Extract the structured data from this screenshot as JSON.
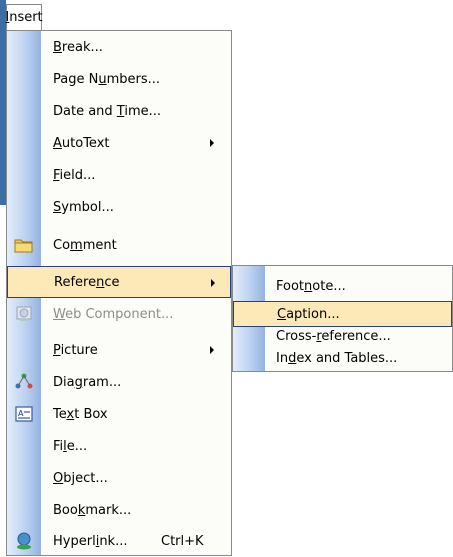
{
  "menu": {
    "title_first": "I",
    "title_rest": "nsert",
    "items": [
      {
        "pre": "",
        "key": "B",
        "post": "reak..."
      },
      {
        "pre": "Page N",
        "key": "u",
        "post": "mbers..."
      },
      {
        "pre": "Date and ",
        "key": "T",
        "post": "ime..."
      },
      {
        "pre": "",
        "key": "A",
        "post": "utoText"
      },
      {
        "pre": "",
        "key": "F",
        "post": "ield..."
      },
      {
        "pre": "",
        "key": "S",
        "post": "ymbol..."
      },
      {
        "pre": "Co",
        "key": "m",
        "post": "ment"
      },
      {
        "pre": "Refere",
        "key": "n",
        "post": "ce"
      },
      {
        "pre": "",
        "key": "W",
        "post": "eb Component..."
      },
      {
        "pre": "",
        "key": "P",
        "post": "icture"
      },
      {
        "pre": "Dia",
        "key": "g",
        "post": "ram..."
      },
      {
        "pre": "Te",
        "key": "x",
        "post": "t Box"
      },
      {
        "pre": "Fi",
        "key": "l",
        "post": "e..."
      },
      {
        "pre": "",
        "key": "O",
        "post": "bject..."
      },
      {
        "pre": "Boo",
        "key": "k",
        "post": "mark..."
      },
      {
        "pre": "Hyperl",
        "key": "i",
        "post": "nk...",
        "shortcut": "Ctrl+K"
      }
    ]
  },
  "submenu": {
    "items": [
      {
        "pre": "Foot",
        "key": "n",
        "post": "ote..."
      },
      {
        "pre": "",
        "key": "C",
        "post": "aption..."
      },
      {
        "pre": "Cross-",
        "key": "r",
        "post": "eference..."
      },
      {
        "pre": "In",
        "key": "d",
        "post": "ex and Tables..."
      }
    ]
  },
  "icons": {
    "comment": "folder-comment-icon",
    "web_component": "web-component-icon",
    "diagram": "diagram-icon",
    "text_box": "text-box-icon",
    "hyperlink": "hyperlink-globe-icon"
  },
  "colors": {
    "highlight": "#fde8b8",
    "highlight_border": "#2a3e8a",
    "strip_dark": "#94b2e0",
    "strip_light": "#e3edfb"
  }
}
